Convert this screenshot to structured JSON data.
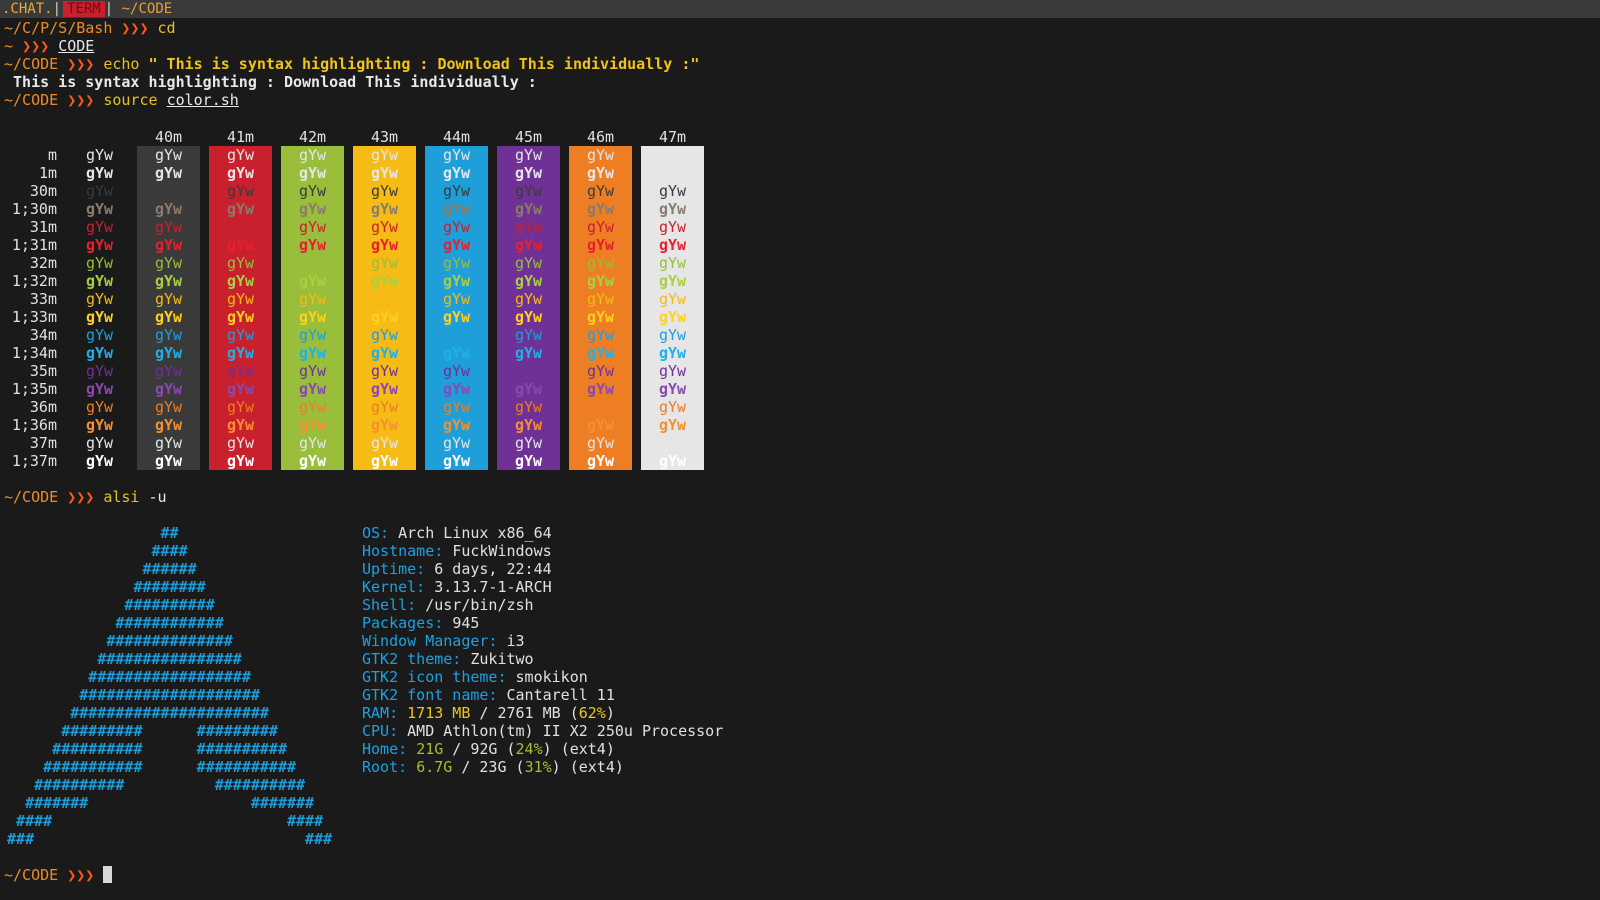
{
  "topbar": {
    "chat_label": ".CHAT.",
    "sep": "|",
    "term_label": "TERM",
    "sep2": "|",
    "path": "~/CODE"
  },
  "prompt_arrows": "❯❯❯",
  "lines": {
    "l1_path": "~/C/P/S/Bash",
    "l1_cmd": "cd",
    "l2_path": "~",
    "l2_cmd": "CODE",
    "l3_path": "~/CODE",
    "l3_cmd": "echo",
    "l3_arg": "\" This is syntax highlighting : Download This individually :\"",
    "l4_output": " This is syntax highlighting : Download This individually :",
    "l5_path": "~/CODE",
    "l5_cmd": "source",
    "l5_arg": "color.sh",
    "l6_path": "~/CODE",
    "l6_cmd": "alsi",
    "l6_arg": "-u",
    "l7_path": "~/CODE"
  },
  "color_table": {
    "sample": "gYw",
    "bg_headers": [
      "40m",
      "41m",
      "42m",
      "43m",
      "44m",
      "45m",
      "46m",
      "47m"
    ],
    "bg_colors": [
      "#3a3a3a",
      "#c8202d",
      "#98be3c",
      "#f6bb14",
      "#1e9fd9",
      "#6f3196",
      "#ee7e24",
      "#e6e6e6"
    ],
    "rows": [
      {
        "label": "m",
        "fg": "#e6e6e6",
        "bold": false
      },
      {
        "label": "1m",
        "fg": "#e6e6e6",
        "bold": true
      },
      {
        "label": "30m",
        "fg": "#3a3a3a",
        "bold": false
      },
      {
        "label": "1;30m",
        "fg": "#8a7b6a",
        "bold": true
      },
      {
        "label": "31m",
        "fg": "#c8202d",
        "bold": false
      },
      {
        "label": "1;31m",
        "fg": "#e8202d",
        "bold": true
      },
      {
        "label": "32m",
        "fg": "#98be3c",
        "bold": false
      },
      {
        "label": "1;32m",
        "fg": "#a8d040",
        "bold": true
      },
      {
        "label": "33m",
        "fg": "#f6bb14",
        "bold": false
      },
      {
        "label": "1;33m",
        "fg": "#ffd020",
        "bold": true
      },
      {
        "label": "34m",
        "fg": "#1e9fd9",
        "bold": false
      },
      {
        "label": "1;34m",
        "fg": "#20b0e8",
        "bold": true
      },
      {
        "label": "35m",
        "fg": "#6f3196",
        "bold": false
      },
      {
        "label": "1;35m",
        "fg": "#8a48b0",
        "bold": true
      },
      {
        "label": "36m",
        "fg": "#ee7e24",
        "bold": false
      },
      {
        "label": "1;36m",
        "fg": "#f59030",
        "bold": true
      },
      {
        "label": "37m",
        "fg": "#e6e6e6",
        "bold": false
      },
      {
        "label": "1;37m",
        "fg": "#ffffff",
        "bold": true
      }
    ]
  },
  "alsi": {
    "logo": [
      "                  ##",
      "                 ####",
      "                ######",
      "               ########",
      "              ##########",
      "             ############",
      "            ##############",
      "           ################",
      "          ##################",
      "         ####################",
      "        ######################",
      "       #########      #########",
      "      ##########      ##########",
      "     ###########      ###########",
      "    ##########          ##########",
      "   #######                  #######",
      "  ####                          ####",
      " ###                              ###"
    ],
    "info": [
      {
        "key": "OS:",
        "value": "Arch Linux x86_64"
      },
      {
        "key": "Hostname:",
        "value": "FuckWindows"
      },
      {
        "key": "Uptime:",
        "value": "6 days, 22:44"
      },
      {
        "key": "Kernel:",
        "value": "3.13.7-1-ARCH"
      },
      {
        "key": "Shell:",
        "value": "/usr/bin/zsh"
      },
      {
        "key": "Packages:",
        "value": "945"
      },
      {
        "key": "Window Manager:",
        "value": "i3"
      },
      {
        "key": "GTK2 theme:",
        "value": "Zukitwo"
      },
      {
        "key": "GTK2 icon theme:",
        "value": "smokikon"
      },
      {
        "key": "GTK2 font name:",
        "value": "Cantarell 11"
      }
    ],
    "ram": {
      "key": "RAM:",
      "used": "1713 MB",
      "total": "2761 MB",
      "pct": "62%"
    },
    "cpu": {
      "key": "CPU:",
      "value": "AMD Athlon(tm) II X2 250u Processor"
    },
    "home": {
      "key": "Home:",
      "used": "21G",
      "total": "92G",
      "pct": "24%",
      "fs": "(ext4)"
    },
    "root": {
      "key": "Root:",
      "used": "6.7G",
      "total": "23G",
      "pct": "31%",
      "fs": "(ext4)"
    }
  }
}
